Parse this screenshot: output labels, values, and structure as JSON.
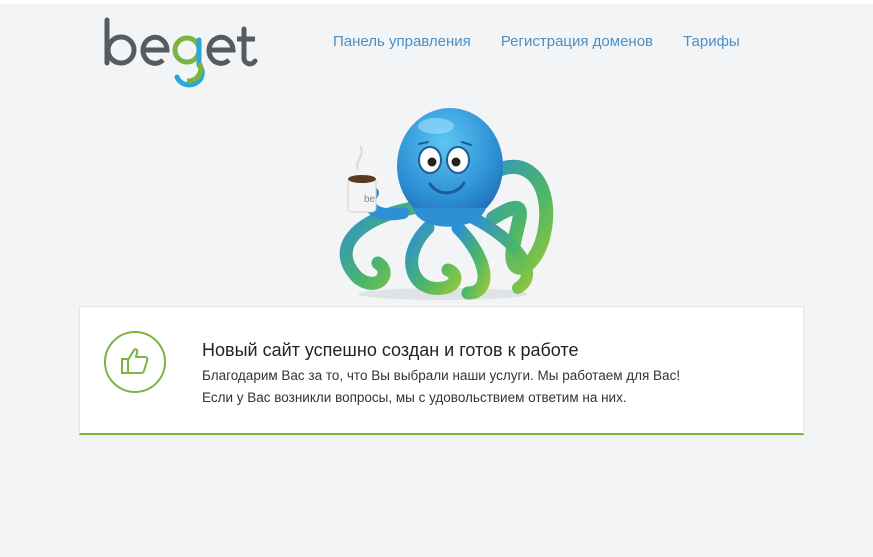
{
  "brand": {
    "logo_text": "beget",
    "colors": {
      "logo_gray": "#555b61",
      "logo_green": "#7cb342",
      "logo_blue": "#29a7d8",
      "link_blue": "#4a8fc6",
      "accent_green": "#7cb342"
    }
  },
  "nav": {
    "items": [
      {
        "label": "Панель управления"
      },
      {
        "label": "Регистрация доменов"
      },
      {
        "label": "Тарифы"
      }
    ]
  },
  "mascot": {
    "icon": "octopus-mascot-icon",
    "mug_text": "be"
  },
  "notice": {
    "icon": "thumbs-up-icon",
    "title": "Новый сайт успешно создан и готов к работе",
    "line1": "Благодарим Вас за то, что Вы выбрали наши услуги. Мы работаем для Вас!",
    "line2": "Если у Вас возникли вопросы, мы с удовольствием ответим на них."
  }
}
